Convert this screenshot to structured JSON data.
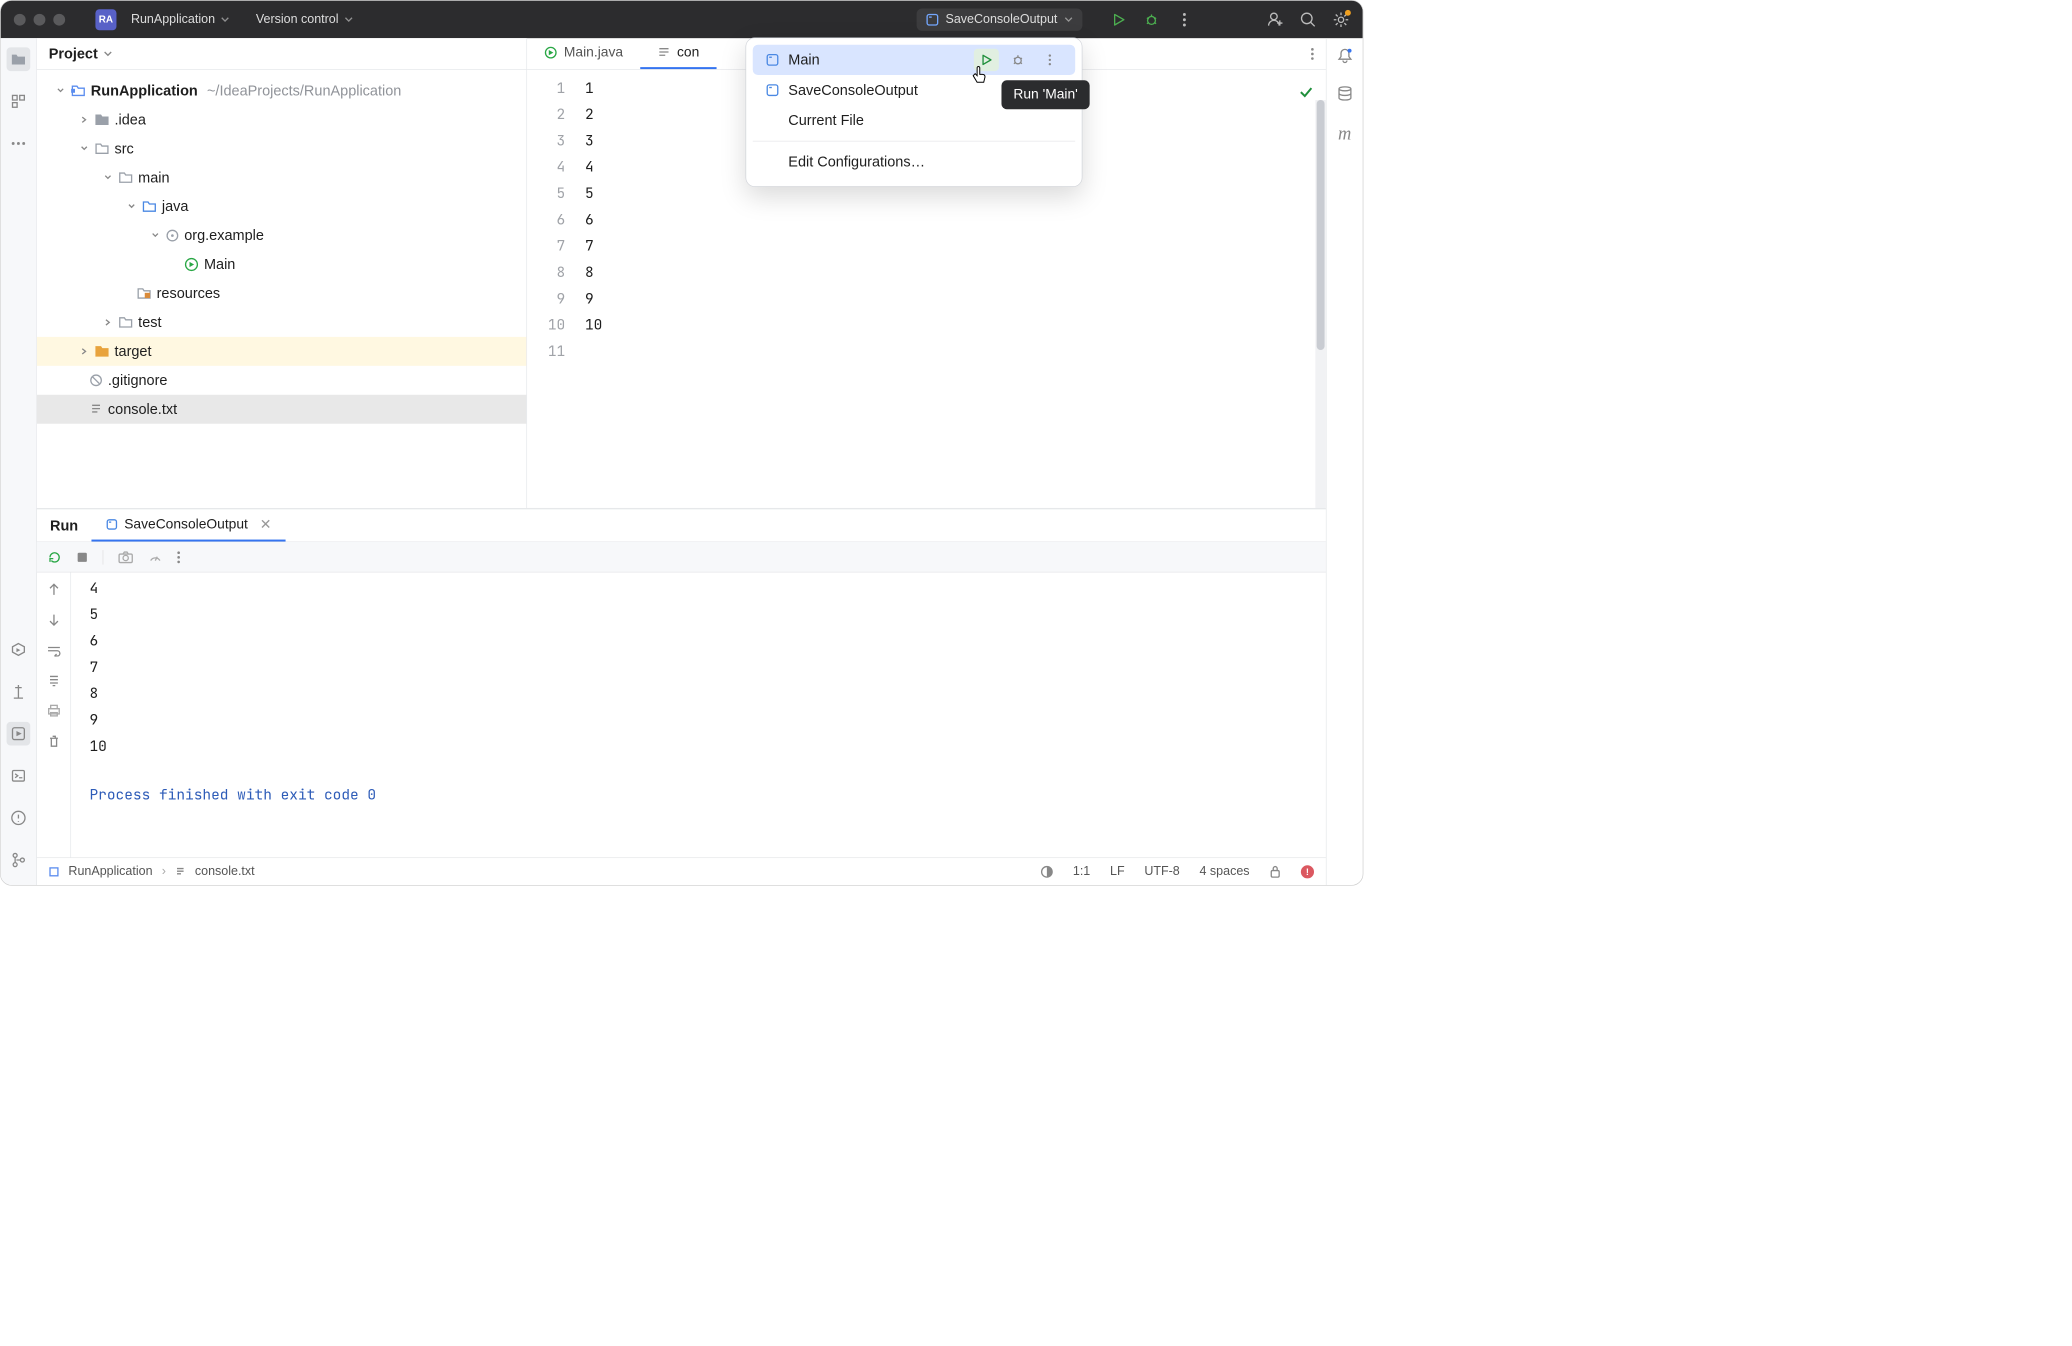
{
  "titlebar": {
    "app_badge": "RA",
    "app_name": "RunApplication",
    "menu_vcs": "Version control",
    "run_config": "SaveConsoleOutput"
  },
  "project": {
    "header": "Project",
    "root": "RunApplication",
    "root_path": "~/IdeaProjects/RunApplication",
    "nodes": {
      "idea": ".idea",
      "src": "src",
      "main": "main",
      "java": "java",
      "pkg": "org.example",
      "main_class": "Main",
      "resources": "resources",
      "test": "test",
      "target": "target",
      "gitignore": ".gitignore",
      "console": "console.txt"
    }
  },
  "editor": {
    "tab1": "Main.java",
    "tab2": "con",
    "gutter": [
      "1",
      "2",
      "3",
      "4",
      "5",
      "6",
      "7",
      "8",
      "9",
      "10",
      "11"
    ],
    "lines": [
      "1",
      "2",
      "3",
      "4",
      "5",
      "6",
      "7",
      "8",
      "9",
      "10",
      ""
    ]
  },
  "popup": {
    "item1": "Main",
    "item2": "SaveConsoleOutput",
    "item3": "Current File",
    "item4": "Edit Configurations…",
    "tooltip": "Run 'Main'"
  },
  "run": {
    "label": "Run",
    "tab": "SaveConsoleOutput",
    "output": [
      "4",
      "5",
      "6",
      "7",
      "8",
      "9",
      "10"
    ],
    "exit": "Process finished with exit code 0"
  },
  "status": {
    "crumb_root": "RunApplication",
    "crumb_file": "console.txt",
    "pos": "1:1",
    "eol": "LF",
    "enc": "UTF-8",
    "indent": "4 spaces"
  }
}
